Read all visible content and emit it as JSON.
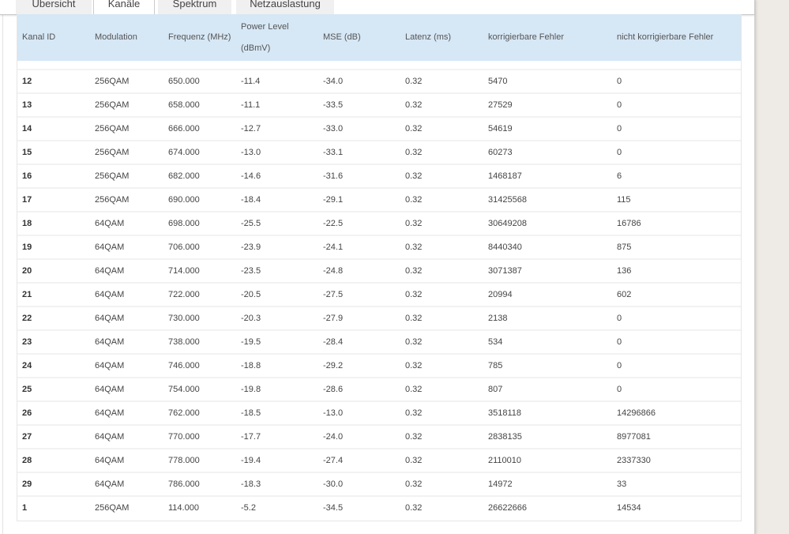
{
  "tabs": [
    {
      "label": "Übersicht",
      "active": false
    },
    {
      "label": "Kanäle",
      "active": true
    },
    {
      "label": "Spektrum",
      "active": false
    },
    {
      "label": "Netzauslastung",
      "active": false
    }
  ],
  "table": {
    "headers": [
      "Kanal ID",
      "Modulation",
      "Frequenz (MHz)",
      "Power Level\n(dBmV)",
      "MSE (dB)",
      "Latenz (ms)",
      "korrigierbare Fehler",
      "nicht korrigierbare Fehler"
    ],
    "header_power_line1": "Power Level",
    "header_power_line2": "(dBmV)",
    "header_bg": "#d6e7f5",
    "rows": [
      [
        "12",
        "256QAM",
        "650.000",
        "-11.4",
        "-34.0",
        "0.32",
        "5470",
        "0"
      ],
      [
        "13",
        "256QAM",
        "658.000",
        "-11.1",
        "-33.5",
        "0.32",
        "27529",
        "0"
      ],
      [
        "14",
        "256QAM",
        "666.000",
        "-12.7",
        "-33.0",
        "0.32",
        "54619",
        "0"
      ],
      [
        "15",
        "256QAM",
        "674.000",
        "-13.0",
        "-33.1",
        "0.32",
        "60273",
        "0"
      ],
      [
        "16",
        "256QAM",
        "682.000",
        "-14.6",
        "-31.6",
        "0.32",
        "1468187",
        "6"
      ],
      [
        "17",
        "256QAM",
        "690.000",
        "-18.4",
        "-29.1",
        "0.32",
        "31425568",
        "115"
      ],
      [
        "18",
        "64QAM",
        "698.000",
        "-25.5",
        "-22.5",
        "0.32",
        "30649208",
        "16786"
      ],
      [
        "19",
        "64QAM",
        "706.000",
        "-23.9",
        "-24.1",
        "0.32",
        "8440340",
        "875"
      ],
      [
        "20",
        "64QAM",
        "714.000",
        "-23.5",
        "-24.8",
        "0.32",
        "3071387",
        "136"
      ],
      [
        "21",
        "64QAM",
        "722.000",
        "-20.5",
        "-27.5",
        "0.32",
        "20994",
        "602"
      ],
      [
        "22",
        "64QAM",
        "730.000",
        "-20.3",
        "-27.9",
        "0.32",
        "2138",
        "0"
      ],
      [
        "23",
        "64QAM",
        "738.000",
        "-19.5",
        "-28.4",
        "0.32",
        "534",
        "0"
      ],
      [
        "24",
        "64QAM",
        "746.000",
        "-18.8",
        "-29.2",
        "0.32",
        "785",
        "0"
      ],
      [
        "25",
        "64QAM",
        "754.000",
        "-19.8",
        "-28.6",
        "0.32",
        "807",
        "0"
      ],
      [
        "26",
        "64QAM",
        "762.000",
        "-18.5",
        "-13.0",
        "0.32",
        "3518118",
        "14296866"
      ],
      [
        "27",
        "64QAM",
        "770.000",
        "-17.7",
        "-24.0",
        "0.32",
        "2838135",
        "8977081"
      ],
      [
        "28",
        "64QAM",
        "778.000",
        "-19.4",
        "-27.4",
        "0.32",
        "2110010",
        "2337330"
      ],
      [
        "29",
        "64QAM",
        "786.000",
        "-18.3",
        "-30.0",
        "0.32",
        "14972",
        "33"
      ],
      [
        "1",
        "256QAM",
        "114.000",
        "-5.2",
        "-34.5",
        "0.32",
        "26622666",
        "14534"
      ]
    ]
  }
}
